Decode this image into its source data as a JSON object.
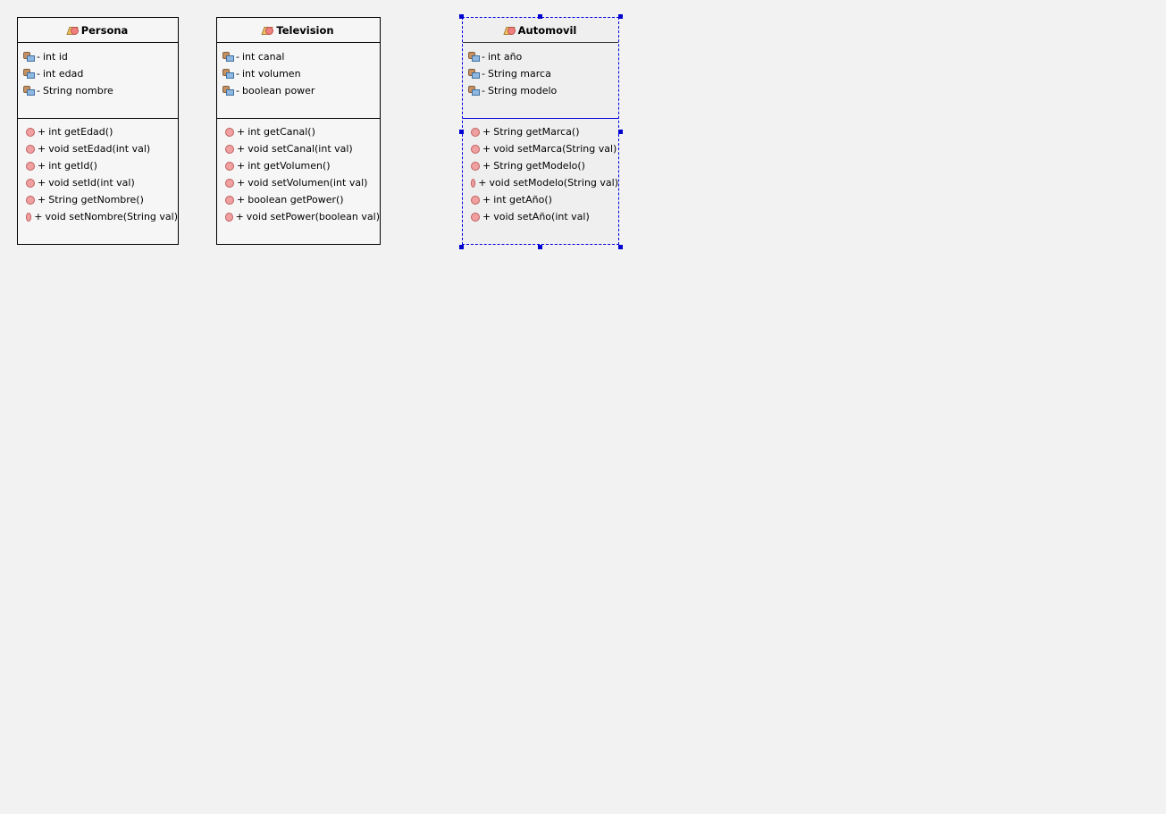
{
  "classes": [
    {
      "name": "Persona",
      "selected": false,
      "attributes": [
        {
          "vis": "-",
          "text": "int id"
        },
        {
          "vis": "-",
          "text": "int edad"
        },
        {
          "vis": "-",
          "text": "String nombre"
        }
      ],
      "methods": [
        {
          "vis": "+",
          "text": "int getEdad()"
        },
        {
          "vis": "+",
          "text": "void setEdad(int val)"
        },
        {
          "vis": "+",
          "text": "int getId()"
        },
        {
          "vis": "+",
          "text": "void setId(int val)"
        },
        {
          "vis": "+",
          "text": "String getNombre()"
        },
        {
          "vis": "+",
          "text": "void setNombre(String val)"
        }
      ]
    },
    {
      "name": "Television",
      "selected": false,
      "attributes": [
        {
          "vis": "-",
          "text": "int canal"
        },
        {
          "vis": "-",
          "text": "int volumen"
        },
        {
          "vis": "-",
          "text": "boolean power"
        }
      ],
      "methods": [
        {
          "vis": "+",
          "text": "int getCanal()"
        },
        {
          "vis": "+",
          "text": "void setCanal(int val)"
        },
        {
          "vis": "+",
          "text": "int getVolumen()"
        },
        {
          "vis": "+",
          "text": "void setVolumen(int val)"
        },
        {
          "vis": "+",
          "text": "boolean getPower()"
        },
        {
          "vis": "+",
          "text": "void setPower(boolean val)"
        }
      ]
    },
    {
      "name": "Automovil",
      "selected": true,
      "attributes": [
        {
          "vis": "-",
          "text": "int año"
        },
        {
          "vis": "-",
          "text": "String marca"
        },
        {
          "vis": "-",
          "text": "String modelo"
        }
      ],
      "methods": [
        {
          "vis": "+",
          "text": "String getMarca()"
        },
        {
          "vis": "+",
          "text": "void setMarca(String val)"
        },
        {
          "vis": "+",
          "text": "String getModelo()"
        },
        {
          "vis": "+",
          "text": "void setModelo(String val)"
        },
        {
          "vis": "+",
          "text": "int getAño()"
        },
        {
          "vis": "+",
          "text": "void setAño(int val)"
        }
      ]
    }
  ],
  "colors": {
    "selection": "#0000e0",
    "canvas": "#f2f2f2"
  }
}
